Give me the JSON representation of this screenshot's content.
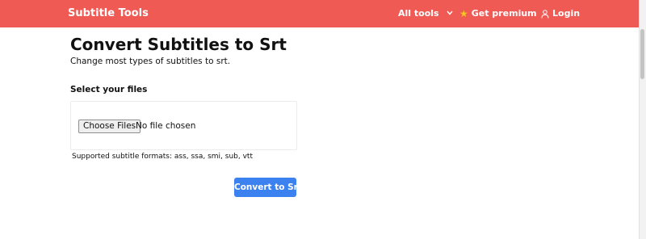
{
  "navbar": {
    "brand": "Subtitle Tools",
    "all_tools_label": "All tools",
    "premium_label": "Get premium",
    "login_label": "Login",
    "icons": {
      "all_tools": "chevron-down-icon",
      "premium": "star-icon",
      "login": "user-icon"
    },
    "background_color": "#f05a55"
  },
  "main": {
    "title": "Convert Subtitles to Srt",
    "subtitle": "Change most types of subtitles to srt.",
    "files_label": "Select your files",
    "file_input": {
      "button_label": "Choose Files",
      "status": "No file chosen"
    },
    "formats_note": "Supported subtitle formats: ass, ssa, smi, sub, vtt",
    "convert_button_label": "Convert to Srt",
    "convert_button_color": "#3b82f0"
  }
}
